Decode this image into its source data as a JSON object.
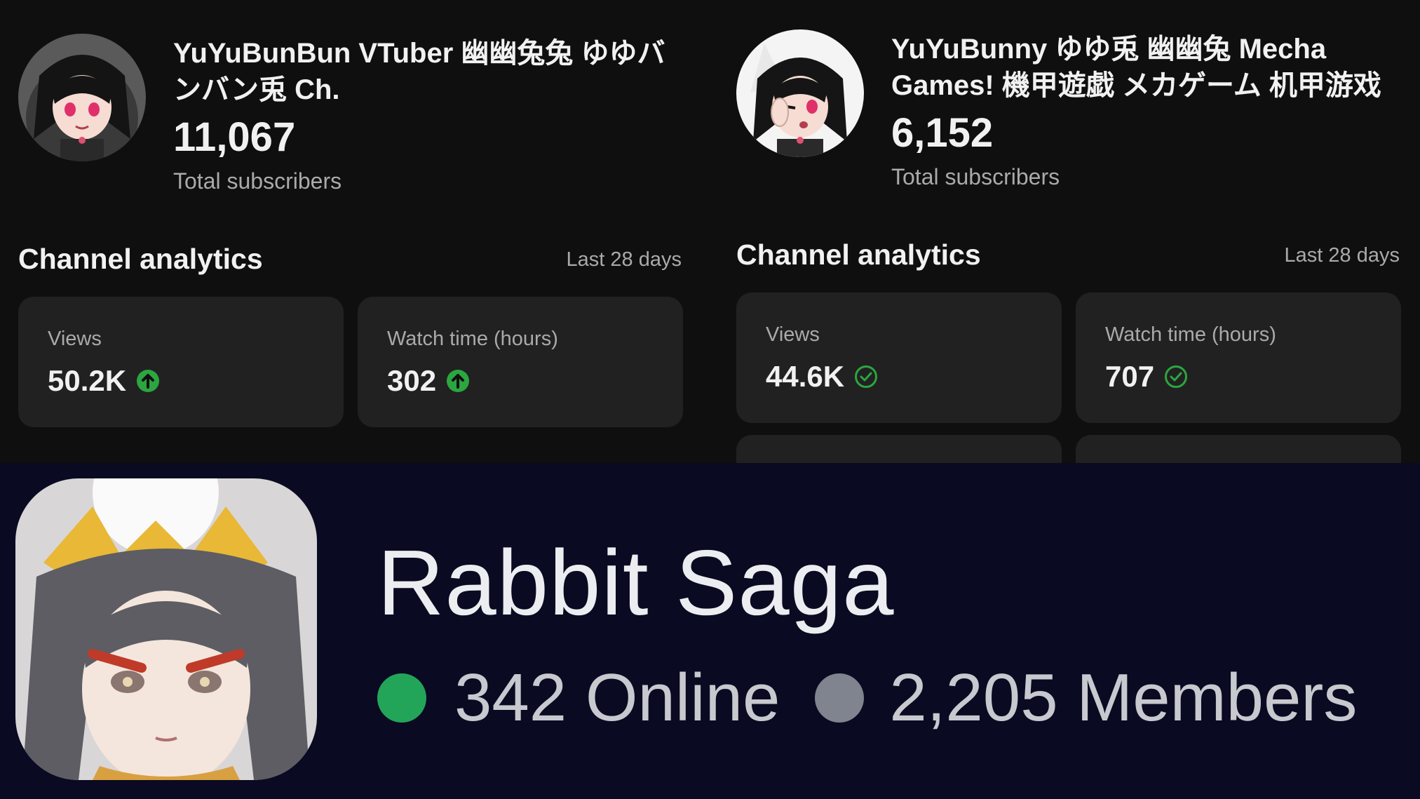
{
  "channels": [
    {
      "name": "YuYuBunBun VTuber 幽幽兔兔 ゆゆバンバン兎 Ch.",
      "subscribers": "11,067",
      "subscribers_label": "Total subscribers",
      "analytics_title": "Channel analytics",
      "period": "Last 28 days",
      "metrics": [
        {
          "label": "Views",
          "value": "50.2K",
          "status_icon": "arrow-up-icon"
        },
        {
          "label": "Watch time (hours)",
          "value": "302",
          "status_icon": "arrow-up-icon"
        }
      ]
    },
    {
      "name": "YuYuBunny ゆゆ兎 幽幽兔 Mecha Games! 機甲遊戯 メカゲーム 机甲游戏",
      "subscribers": "6,152",
      "subscribers_label": "Total subscribers",
      "analytics_title": "Channel analytics",
      "period": "Last 28 days",
      "metrics": [
        {
          "label": "Views",
          "value": "44.6K",
          "status_icon": "check-circle-icon"
        },
        {
          "label": "Watch time (hours)",
          "value": "707",
          "status_icon": "check-circle-icon"
        }
      ]
    }
  ],
  "server": {
    "name": "Rabbit Saga",
    "online": "342 Online",
    "members": "2,205 Members"
  },
  "colors": {
    "up_green": "#2ba640",
    "online_green": "#23a559",
    "members_gray": "#80848e",
    "card_bg": "#212121",
    "discord_bg": "#0a0a22"
  }
}
